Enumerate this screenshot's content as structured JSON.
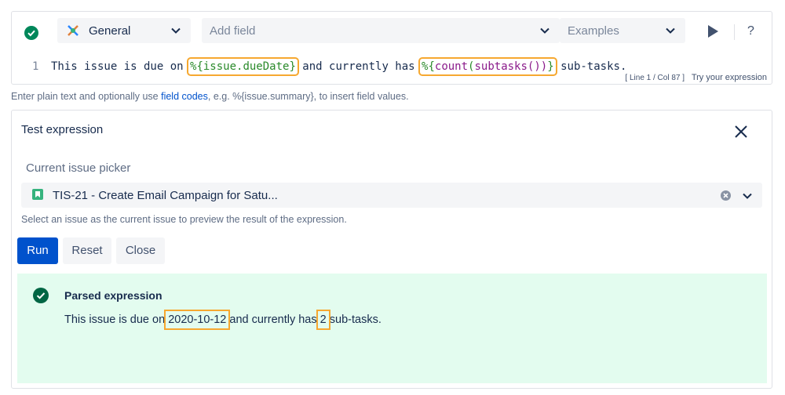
{
  "editor": {
    "type_select": "General",
    "field_placeholder": "Add field",
    "examples_placeholder": "Examples",
    "help_glyph": "?",
    "line_number": "1",
    "code": {
      "t1": "This issue is due on ",
      "t2": "%{issue.dueDate}",
      "t3": " and currently has ",
      "t4a": "%{",
      "t4b": "count",
      "t4c": "(",
      "t4d": "subtasks",
      "t4e": "())",
      "t4f": "}",
      "t5": " sub-tasks."
    },
    "status": "[ Line 1 / Col 87 ]",
    "try_label": "Try your expression"
  },
  "help": {
    "before": "Enter plain text and optionally use ",
    "link": "field codes",
    "after": ", e.g. %{issue.summary}, to insert field values."
  },
  "test": {
    "title": "Test expression",
    "picker_label": "Current issue picker",
    "picker_value": "TIS-21 - Create Email Campaign for Satu...",
    "picker_help": "Select an issue as the current issue to preview the result of the expression.",
    "buttons": {
      "run": "Run",
      "reset": "Reset",
      "close": "Close"
    },
    "result": {
      "title": "Parsed expression",
      "p1": "This issue is due on ",
      "date": "2020-10-12",
      "p2": " and currently has ",
      "count": "2",
      "p3": " sub-tasks."
    }
  },
  "colors": {
    "accent": "#0052cc",
    "success": "#00875a",
    "highlight": "#f6a830",
    "result_bg": "#e3fcef"
  }
}
